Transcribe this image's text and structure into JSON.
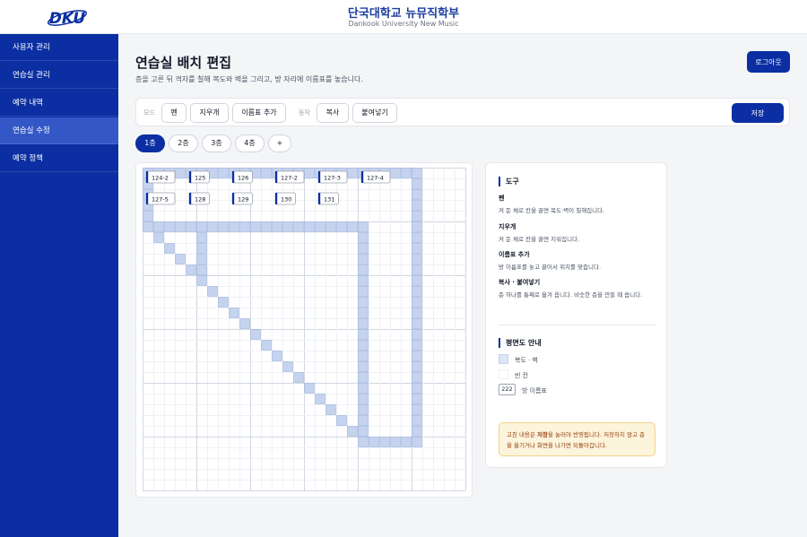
{
  "header": {
    "logo_text": "DKU",
    "title": "단국대학교 뉴뮤직학부",
    "subtitle": "Dankook University New Music"
  },
  "sidebar": {
    "items": [
      {
        "label": "사용자 관리",
        "active": false
      },
      {
        "label": "연습실 관리",
        "active": false
      },
      {
        "label": "예약 내역",
        "active": false
      },
      {
        "label": "연습실 수정",
        "active": true
      },
      {
        "label": "예약 정책",
        "active": false
      }
    ]
  },
  "page": {
    "title": "연습실 배치 편집",
    "description": "층을 고른 뒤 격자를 칠해 복도와 벽을 그리고, 방 자리에 이름표를 놓습니다.",
    "logout_label": "로그아웃"
  },
  "toolbar": {
    "mode_label": "모드",
    "mode_buttons": [
      "펜",
      "지우개",
      "이름표 추가"
    ],
    "action_label": "동작",
    "action_buttons": [
      "복사",
      "붙여넣기"
    ],
    "save_label": "저장"
  },
  "floors": {
    "tabs": [
      "1층",
      "2층",
      "3층",
      "4층"
    ],
    "active": "1층",
    "add_label": "+"
  },
  "grid": {
    "room_labels": [
      "124-2",
      "125",
      "126",
      "127-2",
      "127-3",
      "127-4",
      "127-5",
      "128",
      "129",
      "130",
      "131"
    ]
  },
  "info": {
    "tools_title": "도구",
    "tools": [
      {
        "name": "펜",
        "desc": "켜 둔 채로 칸을 끌면 복도·벽이 칠해집니다."
      },
      {
        "name": "지우개",
        "desc": "켜 둔 채로 칸을 끌면 지워집니다."
      },
      {
        "name": "이름표 추가",
        "desc": "방 이름표를 놓고 끌어서 위치를 맞춥니다."
      },
      {
        "name": "복사 · 붙여넣기",
        "desc": "층 하나를 통째로 옮겨 옵니다. 비슷한 층을 만들 때 씁니다."
      }
    ],
    "legend_title": "평면도 안내",
    "legend_wall": "복도 · 벽",
    "legend_empty": "빈 칸",
    "legend_tag_sample": "222",
    "legend_tag_text": "방 이름표",
    "notice_pre": "고친 내용은 ",
    "notice_bold": "저장",
    "notice_line1_post": "을 눌러야 반영됩니다. 저장하지 않고 층",
    "notice_line2": "을 옮기거나 화면을 나가면 되돌아갑니다."
  },
  "colors": {
    "primary": "#0b2fa2",
    "wall_fill": "#c6d3ee",
    "wall_stroke": "#9fb2de",
    "grid_line": "#eef1f6",
    "grid_major": "#d1d7e2"
  }
}
